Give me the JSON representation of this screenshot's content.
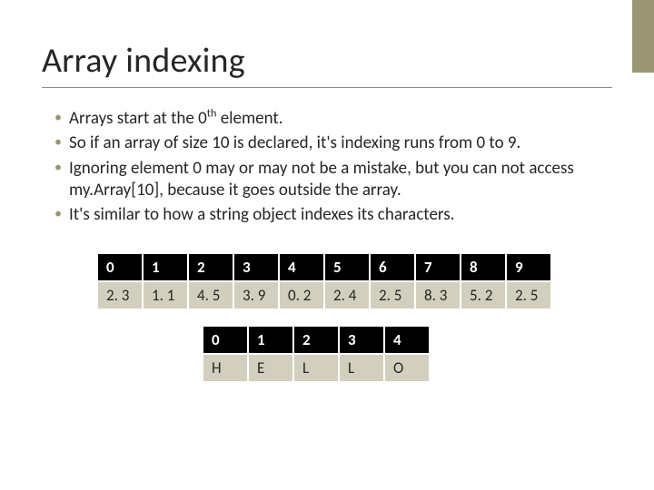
{
  "title": "Array indexing",
  "bullets": [
    "Arrays start at the 0<sup>th</sup> element.",
    "So if an array of size 10 is declared, it's indexing runs from 0 to 9.",
    "Ignoring element 0 may or may not be a mistake, but you can not access my.Array[10], because it goes outside the array.",
    "It's similar to how a string object indexes its characters."
  ],
  "table1": {
    "indices": [
      "0",
      "1",
      "2",
      "3",
      "4",
      "5",
      "6",
      "7",
      "8",
      "9"
    ],
    "values": [
      "2. 3",
      "1. 1",
      "4. 5",
      "3. 9",
      "0. 2",
      "2. 4",
      "2. 5",
      "8. 3",
      "5. 2",
      "2. 5"
    ]
  },
  "table2": {
    "indices": [
      "0",
      "1",
      "2",
      "3",
      "4"
    ],
    "values": [
      "H",
      "E",
      "L",
      "L",
      "O"
    ]
  }
}
